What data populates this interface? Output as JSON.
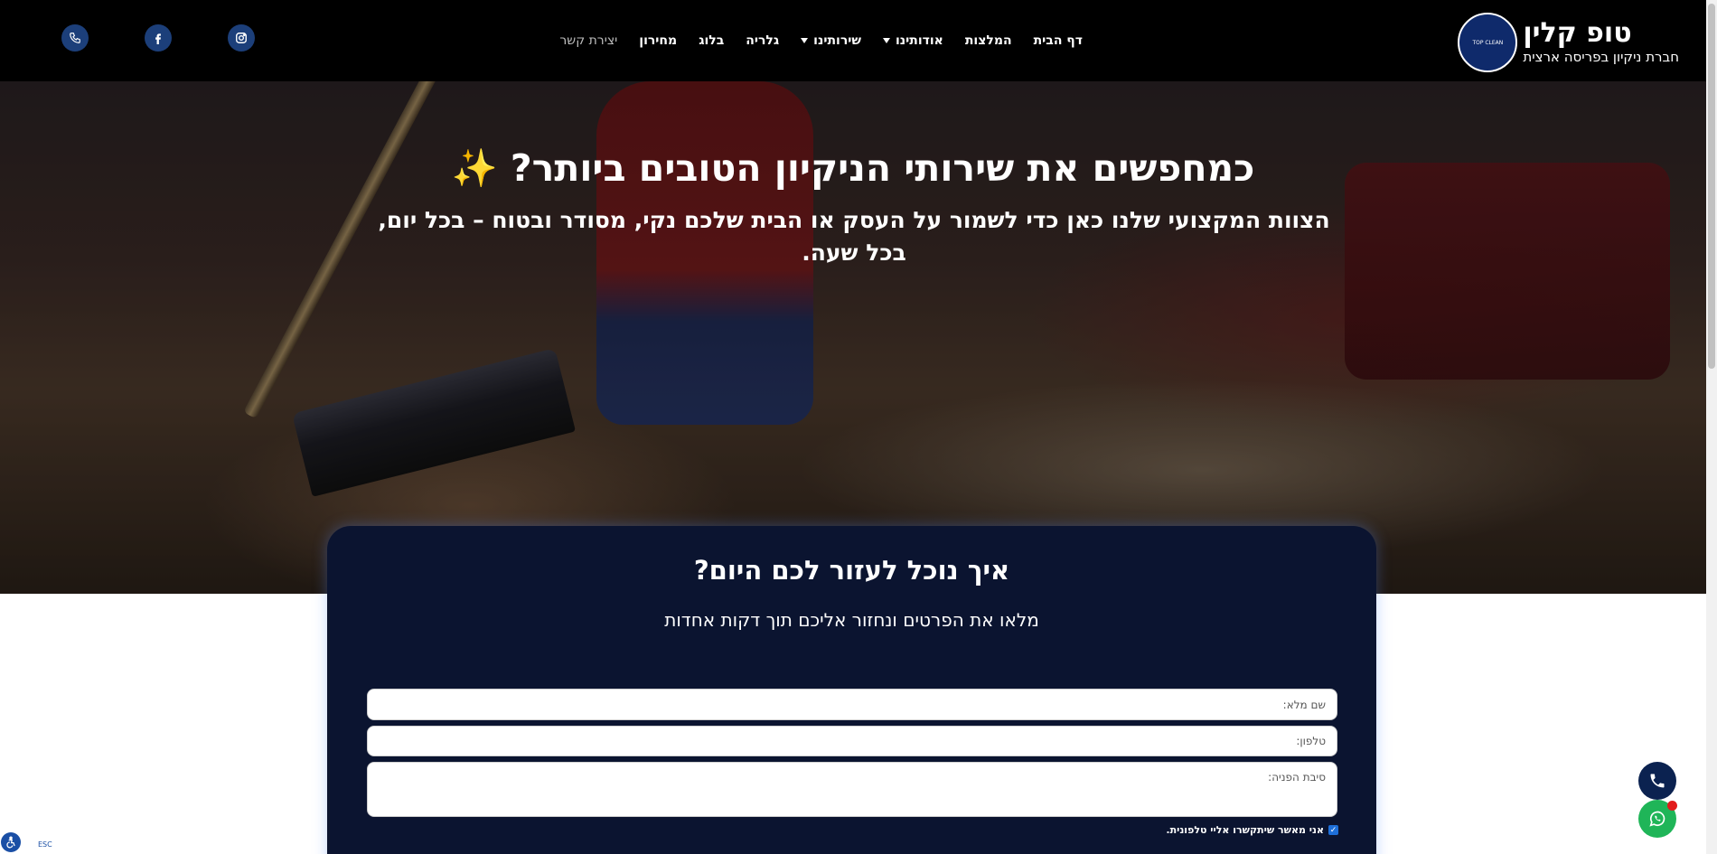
{
  "header": {
    "brand_name": "טופ קלין",
    "brand_sub": "חברת ניקיון בפריסה ארצית",
    "logo_text": "TOP CLEAN",
    "nav": [
      {
        "label": "דף הבית",
        "dropdown": false
      },
      {
        "label": "המלצות",
        "dropdown": false
      },
      {
        "label": "אודותינו",
        "dropdown": true
      },
      {
        "label": "שירותינו",
        "dropdown": true
      },
      {
        "label": "גלריה",
        "dropdown": false
      },
      {
        "label": "בלוג",
        "dropdown": false
      },
      {
        "label": "מחירון",
        "dropdown": false
      },
      {
        "label": "יצירת קשר",
        "dropdown": false
      }
    ],
    "social_icons": [
      "instagram-icon",
      "facebook-icon",
      "phone-icon"
    ]
  },
  "hero": {
    "title": "כמחפשים את שירותי הניקיון הטובים ביותר? ✨",
    "subtitle": "הצוות המקצועי שלנו כאן כדי לשמור על העסק או הבית שלכם נקי, מסודר ובטוח – בכל יום, בכל שעה."
  },
  "form": {
    "title": "איך נוכל לעזור לכם היום?",
    "subtitle": "מלאו את הפרטים ונחזור אליכם תוך דקות אחדות",
    "name_placeholder": "שם מלא:",
    "phone_placeholder": "טלפון:",
    "reason_placeholder": "סיבת הפניה:",
    "consent_label": "אני מאשר שיתקשרו אליי טלפונית.",
    "consent_checked": true
  },
  "widgets": {
    "esc_label": "ESC"
  },
  "colors": {
    "header_bg": "#000000",
    "card_bg": "#0b1430",
    "accent_blue": "#1c3f7a",
    "whatsapp_green": "#1fb558"
  }
}
